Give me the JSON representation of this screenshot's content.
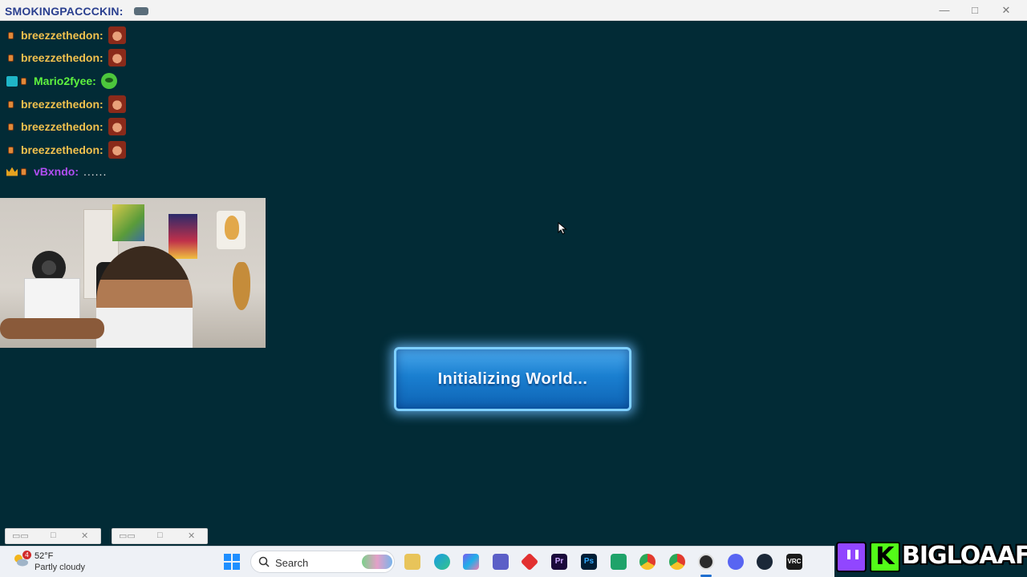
{
  "window": {
    "title": "SMOKINGPACCCKIN:",
    "minimize_icon": "minimize-icon",
    "maximize_icon": "maximize-icon",
    "close_icon": "close-icon"
  },
  "chat": {
    "messages": [
      {
        "user": "breezzethedon:",
        "color": "#f2c14e",
        "badges": [
          "sub-badge"
        ],
        "content_type": "emote",
        "emote": "face-emote"
      },
      {
        "user": "breezzethedon:",
        "color": "#f2c14e",
        "badges": [
          "sub-badge"
        ],
        "content_type": "emote",
        "emote": "face-emote"
      },
      {
        "user": "Mario2fyee:",
        "color": "#5ef23f",
        "badges": [
          "moderator-badge",
          "sub-badge"
        ],
        "content_type": "emote",
        "emote": "frog-emote"
      },
      {
        "user": "breezzethedon:",
        "color": "#f2c14e",
        "badges": [
          "sub-badge"
        ],
        "content_type": "emote",
        "emote": "face-emote"
      },
      {
        "user": "breezzethedon:",
        "color": "#f2c14e",
        "badges": [
          "sub-badge"
        ],
        "content_type": "emote",
        "emote": "face-emote"
      },
      {
        "user": "breezzethedon:",
        "color": "#f2c14e",
        "badges": [
          "sub-badge"
        ],
        "content_type": "emote",
        "emote": "face-emote"
      },
      {
        "user": "vBxndo:",
        "color": "#b04ef2",
        "badges": [
          "crown-badge",
          "sub-badge"
        ],
        "content_type": "text",
        "text": "......"
      }
    ]
  },
  "loading": {
    "text": "Initializing World..."
  },
  "taskbar": {
    "weather": {
      "temp": "52°F",
      "condition": "Partly cloudy",
      "notification_count": "4"
    },
    "search_label": "Search",
    "apps": [
      "file-explorer-icon",
      "edge-icon",
      "copilot-icon",
      "teams-icon",
      "red-app-icon",
      "premiere-pro-icon",
      "photoshop-icon",
      "green-app-icon",
      "chrome-icon",
      "chrome-icon",
      "obs-icon",
      "discord-icon",
      "steam-icon",
      "vrchat-icon"
    ],
    "app_labels": {
      "premiere": "Pr",
      "photoshop": "Ps",
      "vrchat": "VRC"
    }
  },
  "brand": {
    "name": "BIGLOAAF",
    "twitch_icon": "twitch-icon",
    "kick_icon": "kick-icon",
    "kick_letter": "K"
  },
  "colors": {
    "background": "#022b36",
    "button_blue": "#1a7fd0",
    "accent_glow": "#7fd0ff"
  }
}
